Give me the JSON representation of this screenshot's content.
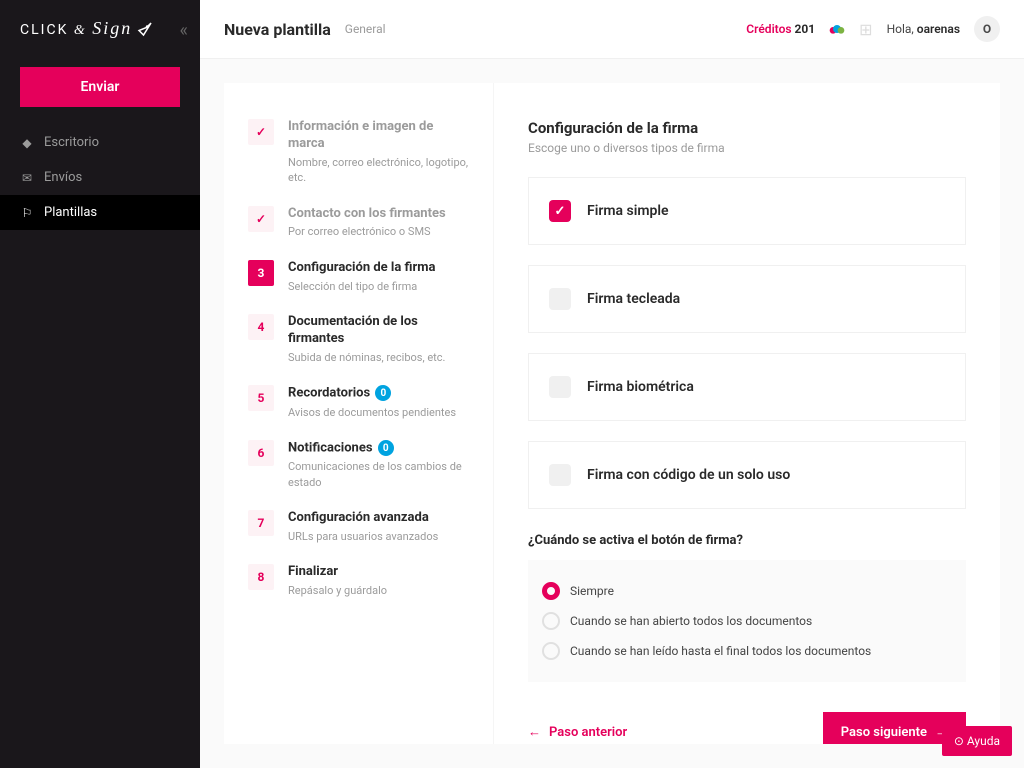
{
  "brand": {
    "prefix": "CLICK",
    "amp": "&",
    "suffix": "Sign"
  },
  "sidebar": {
    "send_label": "Enviar",
    "items": [
      {
        "label": "Escritorio",
        "icon": "◆"
      },
      {
        "label": "Envíos",
        "icon": "✉"
      },
      {
        "label": "Plantillas",
        "icon": "⚐"
      }
    ]
  },
  "header": {
    "title": "Nueva plantilla",
    "breadcrumb": "General",
    "credits_label": "Créditos",
    "credits_value": "201",
    "greeting": "Hola,",
    "username": "oarenas",
    "avatar": "O"
  },
  "steps": [
    {
      "num": "✓",
      "title": "Información e imagen de marca",
      "sub": "Nombre, correo electrónico, logotipo, etc.",
      "state": "done"
    },
    {
      "num": "✓",
      "title": "Contacto con los firmantes",
      "sub": "Por correo electrónico o SMS",
      "state": "done"
    },
    {
      "num": "3",
      "title": "Configuración de la firma",
      "sub": "Selección del tipo de firma",
      "state": "active"
    },
    {
      "num": "4",
      "title": "Documentación de los firmantes",
      "sub": "Subida de nóminas, recibos, etc.",
      "state": "pending"
    },
    {
      "num": "5",
      "title": "Recordatorios",
      "sub": "Avisos de documentos pendientes",
      "state": "pending",
      "badge": "0"
    },
    {
      "num": "6",
      "title": "Notificaciones",
      "sub": "Comunicaciones de los cambios de estado",
      "state": "pending",
      "badge": "0"
    },
    {
      "num": "7",
      "title": "Configuración avanzada",
      "sub": "URLs para usuarios avanzados",
      "state": "pending"
    },
    {
      "num": "8",
      "title": "Finalizar",
      "sub": "Repásalo y guárdalo",
      "state": "pending"
    }
  ],
  "panel": {
    "title": "Configuración de la firma",
    "subtitle": "Escoge uno o diversos tipos de firma",
    "options": [
      {
        "label": "Firma simple",
        "checked": true
      },
      {
        "label": "Firma tecleada",
        "checked": false
      },
      {
        "label": "Firma biométrica",
        "checked": false
      },
      {
        "label": "Firma con código de un solo uso",
        "checked": false
      }
    ],
    "question": "¿Cuándo se activa el botón de firma?",
    "radios": [
      {
        "label": "Siempre",
        "checked": true
      },
      {
        "label": "Cuando se han abierto todos los documentos",
        "checked": false
      },
      {
        "label": "Cuando se han leído hasta el final todos los documentos",
        "checked": false
      }
    ],
    "prev": "Paso anterior",
    "next": "Paso siguiente"
  },
  "help": "Ayuda"
}
